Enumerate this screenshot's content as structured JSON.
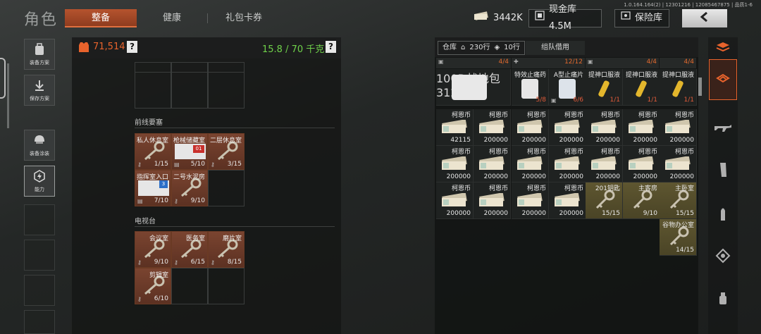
{
  "header": {
    "title": "角色",
    "tabs": [
      {
        "label": "整备",
        "active": true
      },
      {
        "label": "健康",
        "active": false
      },
      {
        "label": "礼包卡券",
        "active": false
      }
    ],
    "version": "1.0.164.164(2) | 12301216 | 12085467875 | 品质1-6",
    "money": "3442K",
    "cash_vault": "现金库 4.5M",
    "safe_vault": "保险库"
  },
  "left_sidebar": {
    "buttons": [
      {
        "label": "装备方案",
        "icon": "backpack-icon"
      },
      {
        "label": "保存方案",
        "icon": "download-icon"
      },
      {
        "label": "装备涂装",
        "icon": "helmet-icon"
      },
      {
        "label": "能力",
        "icon": "ability-icon"
      }
    ]
  },
  "left_panel": {
    "value": "71,514",
    "value_help": "?",
    "weight": "15.8 / 70 千克",
    "weight_help": "?",
    "sections": [
      {
        "title": "前线要塞",
        "items": [
          {
            "name": "私人休息室",
            "count": "1/15",
            "type": "key"
          },
          {
            "name": "枪械储藏室",
            "count": "5/10",
            "type": "card",
            "card_label": "01"
          },
          {
            "name": "二层休息室",
            "count": "3/15",
            "type": "key"
          },
          {
            "name": "指挥室入口",
            "count": "7/10",
            "type": "card",
            "card_label": "3"
          },
          {
            "name": "二号水泥房",
            "count": "9/10",
            "type": "key"
          }
        ]
      },
      {
        "title": "电视台",
        "items": [
          {
            "name": "会议室",
            "count": "9/10",
            "type": "key"
          },
          {
            "name": "医务室",
            "count": "6/15",
            "type": "key"
          },
          {
            "name": "磨片室",
            "count": "8/15",
            "type": "key"
          },
          {
            "name": "剪辑室",
            "count": "6/10",
            "type": "key"
          }
        ]
      }
    ]
  },
  "right_panel": {
    "tab_storage": "仓库",
    "rows_label": "230行",
    "tag_rows_label": "10行",
    "tab_team": "组队借用",
    "capacity": [
      "4/4",
      "12/12",
      "4/4",
      "4/4"
    ],
    "top_items": [
      {
        "name": "100D战地包",
        "count": "312/400",
        "red": true,
        "wide": true
      },
      {
        "name": "特效止痛药",
        "count": "5/8",
        "red": true
      },
      {
        "name": "A型止痛片",
        "count": "6/6",
        "red": true
      },
      {
        "name": "提神口服液",
        "count": "1/1",
        "red": true
      },
      {
        "name": "提神口服液",
        "count": "1/1",
        "red": true
      },
      {
        "name": "提神口服液",
        "count": "1/1",
        "red": true
      }
    ],
    "money_rows": [
      [
        {
          "name": "柯恩币",
          "count": "42115"
        },
        {
          "name": "柯恩币",
          "count": "200000"
        },
        {
          "name": "柯恩币",
          "count": "200000"
        },
        {
          "name": "柯恩币",
          "count": "200000"
        },
        {
          "name": "柯恩币",
          "count": "200000"
        },
        {
          "name": "柯恩币",
          "count": "200000"
        },
        {
          "name": "柯恩币",
          "count": "200000"
        }
      ],
      [
        {
          "name": "柯恩币",
          "count": "200000"
        },
        {
          "name": "柯恩币",
          "count": "200000"
        },
        {
          "name": "柯恩币",
          "count": "200000"
        },
        {
          "name": "柯恩币",
          "count": "200000"
        },
        {
          "name": "柯恩币",
          "count": "200000"
        },
        {
          "name": "柯恩币",
          "count": "200000"
        },
        {
          "name": "柯恩币",
          "count": "200000"
        }
      ],
      [
        {
          "name": "柯恩币",
          "count": "200000"
        },
        {
          "name": "柯恩币",
          "count": "200000"
        },
        {
          "name": "柯恩币",
          "count": "200000"
        },
        {
          "name": "柯恩币",
          "count": "200000"
        },
        {
          "name": "201钥匙",
          "count": "15/15",
          "key": true
        },
        {
          "name": "主客房",
          "count": "9/10",
          "key": true
        },
        {
          "name": "主卧室",
          "count": "15/15",
          "key": true
        }
      ]
    ],
    "extra_key": {
      "name": "谷物办公室",
      "count": "14/15"
    }
  },
  "right_sidebar": {
    "icons": [
      "stack-icon",
      "equipment-icon",
      "rifle-icon",
      "magazine-icon",
      "ammo-icon",
      "attachment-icon",
      "grenade-icon"
    ]
  }
}
